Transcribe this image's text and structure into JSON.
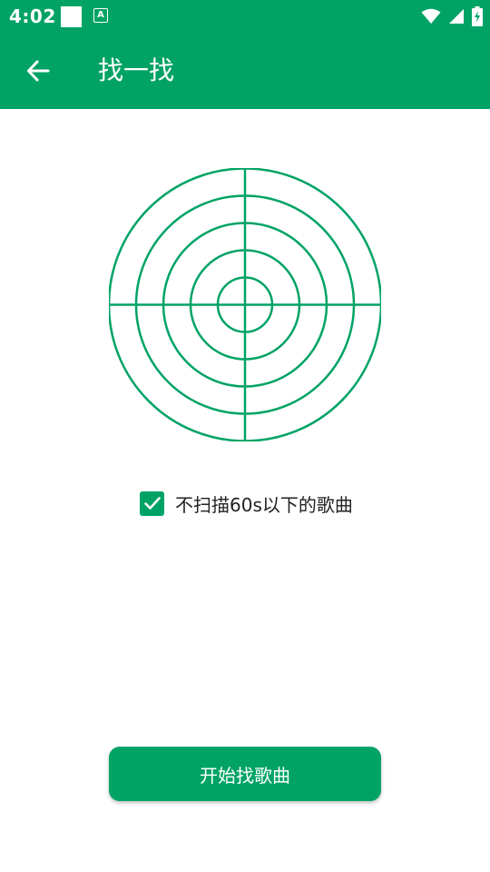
{
  "colors": {
    "primary": "#00a365",
    "on_primary": "#ffffff",
    "text": "#222222"
  },
  "status_bar": {
    "time": "4:02",
    "notification_a": "A",
    "icons": [
      "square-notification-icon",
      "a-notification-icon",
      "wifi-icon",
      "cell-signal-icon",
      "battery-charging-icon"
    ]
  },
  "app_bar": {
    "back_icon": "arrow-back-icon",
    "title": "找一找"
  },
  "radar": {
    "icon": "radar-target-icon",
    "ring_count": 5
  },
  "filter": {
    "checked": true,
    "label": "不扫描60s以下的歌曲"
  },
  "start_button": {
    "label": "开始找歌曲"
  }
}
